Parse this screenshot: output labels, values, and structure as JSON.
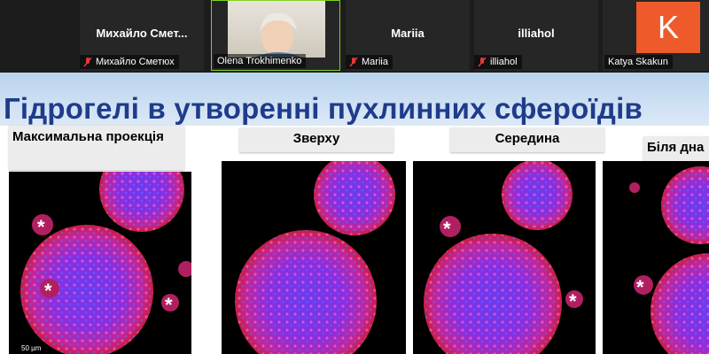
{
  "participants": [
    {
      "tile_name": "Михайло  Смет...",
      "caption": "Михайло Сметюх",
      "muted": true
    },
    {
      "tile_name": "",
      "caption": "Olena Trokhimenko",
      "muted": false,
      "active": true
    },
    {
      "tile_name": "Mariia",
      "caption": "Mariia",
      "muted": true
    },
    {
      "tile_name": "illiahol",
      "caption": "illiahol",
      "muted": true
    },
    {
      "tile_name": "",
      "caption": "Katya Skakun",
      "muted": false,
      "avatar_letter": "K"
    }
  ],
  "slide": {
    "title": "Гідрогелі в утворенні пухлинних сфероїдів",
    "panels": [
      {
        "label": "Максимальна проекція",
        "markers": [
          "*",
          "*",
          "*"
        ],
        "scale": "50 µm"
      },
      {
        "label": "Зверху",
        "markers": []
      },
      {
        "label": "Середина",
        "markers": [
          "*",
          "*"
        ]
      },
      {
        "label": "Біля дна",
        "markers": [
          "*"
        ]
      }
    ]
  },
  "colors": {
    "accent_orange": "#ef5a2a",
    "title_blue": "#1f3c8a",
    "active_border": "#7ed321",
    "mic_muted": "#e53935"
  }
}
